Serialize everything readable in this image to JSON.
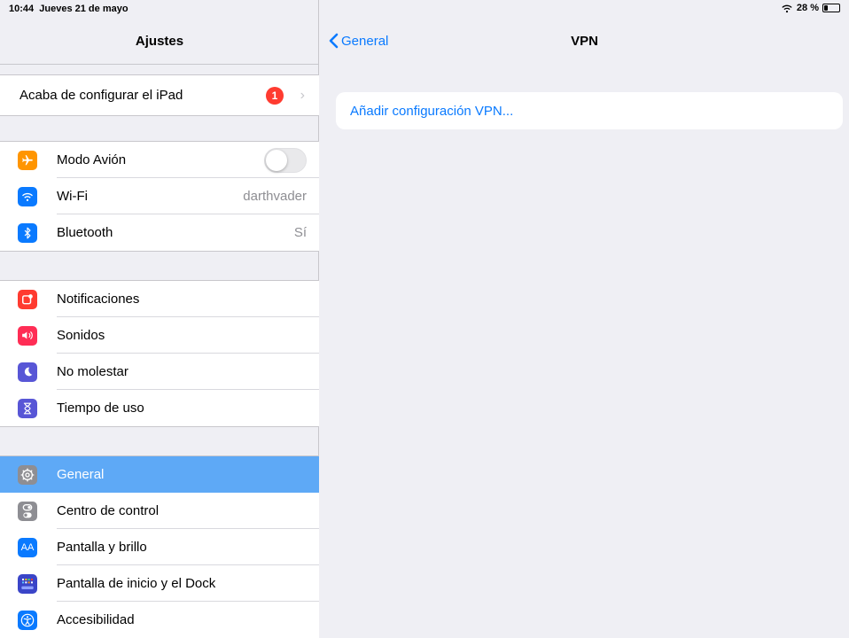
{
  "status": {
    "time": "10:44",
    "date": "Jueves 21 de mayo",
    "battery_text": "28 %",
    "battery_level": 0.28
  },
  "master": {
    "title": "Ajustes",
    "ipad_setup": {
      "label": "Acaba de configurar el iPad",
      "badge": "1"
    },
    "connectivity": [
      {
        "label": "Modo Avión",
        "icon": "airplane-icon",
        "color": "#ff9500",
        "toggle": false
      },
      {
        "label": "Wi-Fi",
        "icon": "wifi-icon",
        "color": "#0a7aff",
        "value": "darthvader"
      },
      {
        "label": "Bluetooth",
        "icon": "bluetooth-icon",
        "color": "#0a7aff",
        "value": "Sí"
      }
    ],
    "notifications": [
      {
        "label": "Notificaciones",
        "icon": "notifications-icon",
        "color": "#ff3b30"
      },
      {
        "label": "Sonidos",
        "icon": "sounds-icon",
        "color": "#ff2d55"
      },
      {
        "label": "No molestar",
        "icon": "moon-icon",
        "color": "#5856d6"
      },
      {
        "label": "Tiempo de uso",
        "icon": "hourglass-icon",
        "color": "#5856d6"
      }
    ],
    "general": [
      {
        "label": "General",
        "icon": "gear-icon",
        "color": "#8e8e93",
        "selected": true
      },
      {
        "label": "Centro de control",
        "icon": "switches-icon",
        "color": "#8e8e93"
      },
      {
        "label": "Pantalla y brillo",
        "icon": "text-size-icon",
        "color": "#0a7aff",
        "glyph": "AA"
      },
      {
        "label": "Pantalla de inicio y el Dock",
        "icon": "home-screen-icon",
        "color": "#3a45c8"
      },
      {
        "label": "Accesibilidad",
        "icon": "accessibility-icon",
        "color": "#0a7aff"
      }
    ]
  },
  "detail": {
    "back_label": "General",
    "title": "VPN",
    "add_config_label": "Añadir configuración VPN..."
  },
  "colors": {
    "accent": "#0a7aff",
    "selected_row": "#5ea9f6",
    "badge": "#ff3b30"
  }
}
